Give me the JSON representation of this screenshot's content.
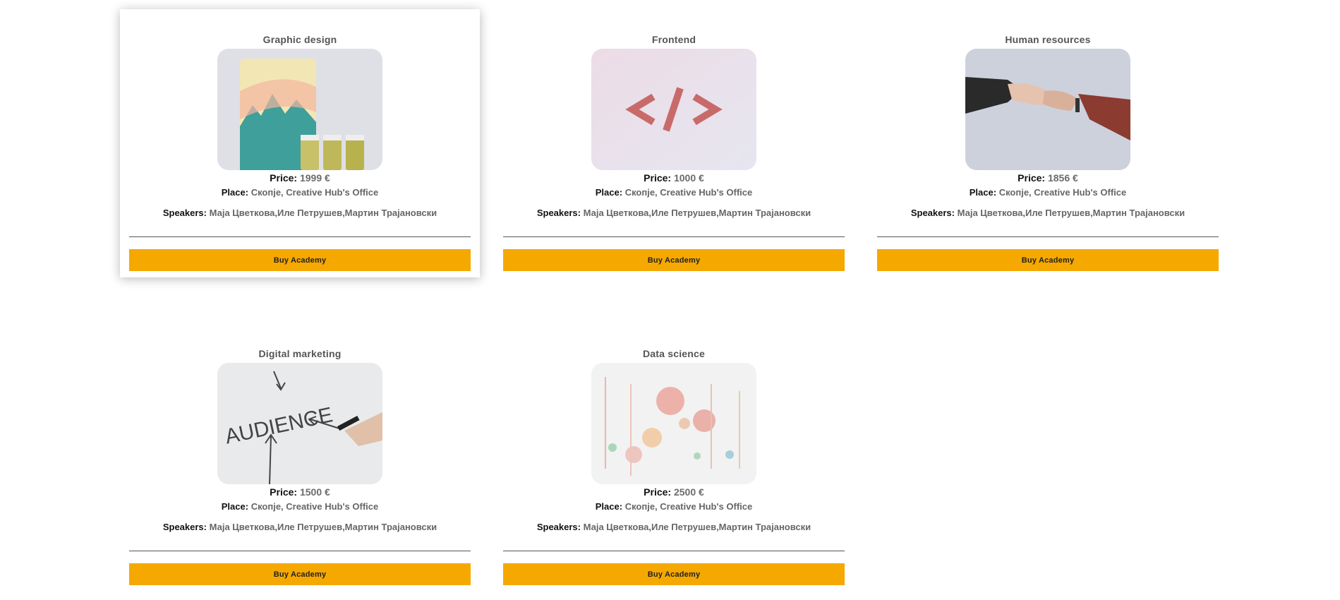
{
  "cards": [
    {
      "title": "Graphic design",
      "price_label": "Price:",
      "price_value": "1999 €",
      "place_label": "Place:",
      "place_value": "Скопје, Creative Hub's Office",
      "speakers_label": "Speakers:",
      "speakers_value": "Маја Цветкова,Иле Петрушев,Мартин Трајановски",
      "button_label": "Buy Academy",
      "image_icon": "coffee-pouch-image"
    },
    {
      "title": "Frontend",
      "price_label": "Price:",
      "price_value": "1000 €",
      "place_label": "Place:",
      "place_value": "Скопје, Creative Hub's Office",
      "speakers_label": "Speakers:",
      "speakers_value": "Маја Цветкова,Иле Петрушев,Мартин Трајановски",
      "button_label": "Buy Academy",
      "image_icon": "code-brackets-image"
    },
    {
      "title": "Human resources",
      "price_label": "Price:",
      "price_value": "1856 €",
      "place_label": "Place:",
      "place_value": "Скопје, Creative Hub's Office",
      "speakers_label": "Speakers:",
      "speakers_value": "Маја Цветкова,Иле Петрушев,Мартин Трајановски",
      "button_label": "Buy Academy",
      "image_icon": "handshake-image"
    },
    {
      "title": "Digital marketing",
      "price_label": "Price:",
      "price_value": "1500 €",
      "place_label": "Place:",
      "place_value": "Скопје, Creative Hub's Office",
      "speakers_label": "Speakers:",
      "speakers_value": "Маја Цветкова,Иле Петрушев,Мартин Трајановски",
      "button_label": "Buy Academy",
      "image_icon": "audience-whiteboard-image",
      "image_text": "AUDIENCE"
    },
    {
      "title": "Data science",
      "price_label": "Price:",
      "price_value": "2500 €",
      "place_label": "Place:",
      "place_value": "Скопје, Creative Hub's Office",
      "speakers_label": "Speakers:",
      "speakers_value": "Маја Цветкова,Иле Петрушев,Мартин Трајановски",
      "button_label": "Buy Academy",
      "image_icon": "data-bubbles-image"
    }
  ],
  "colors": {
    "button_bg": "#f5a800",
    "title": "#555555",
    "value_text": "#666666"
  }
}
